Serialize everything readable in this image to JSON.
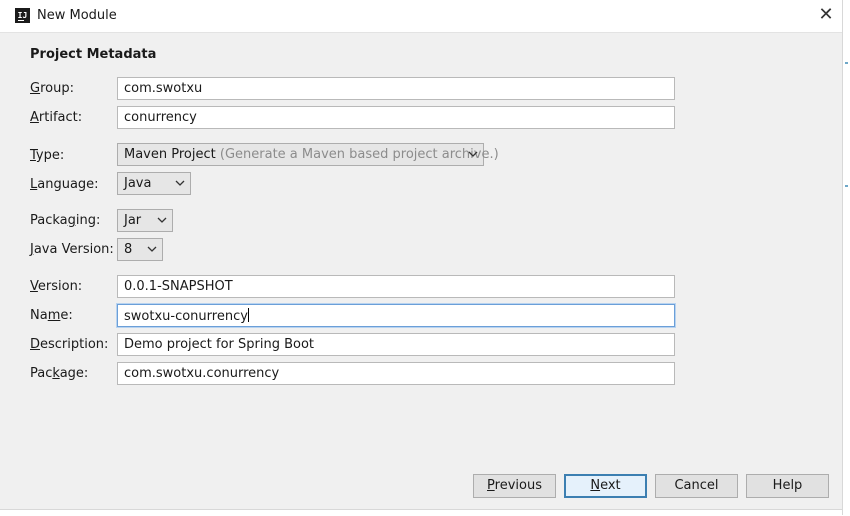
{
  "window": {
    "title": "New Module",
    "close_glyph": "✕"
  },
  "section_title": "Project Metadata",
  "fields": {
    "group": {
      "label_mnemonic": "G",
      "label_rest": "roup:",
      "value": "com.swotxu"
    },
    "artifact": {
      "label_mnemonic": "A",
      "label_rest": "rtifact:",
      "value": "conurrency"
    },
    "type": {
      "label_mnemonic": "T",
      "label_rest": "ype:",
      "value": "Maven Project",
      "hint": "(Generate a Maven based project archive.)"
    },
    "language": {
      "label_mnemonic": "L",
      "label_rest": "anguage:",
      "value": "Java"
    },
    "packaging": {
      "label_pre": "Packa",
      "label_mnemonic": "g",
      "label_rest": "ing:",
      "value": "Jar"
    },
    "java_version": {
      "label_mnemonic": "J",
      "label_rest": "ava Version:",
      "value": "8"
    },
    "version": {
      "label_mnemonic": "V",
      "label_rest": "ersion:",
      "value": "0.0.1-SNAPSHOT"
    },
    "name": {
      "label_pre": "Na",
      "label_mnemonic": "m",
      "label_rest": "e:",
      "value": "swotxu-conurrency"
    },
    "description": {
      "label_mnemonic": "D",
      "label_rest": "escription:",
      "value": "Demo project for Spring Boot"
    },
    "package": {
      "label_pre": "Pac",
      "label_mnemonic": "k",
      "label_rest": "age:",
      "value": "com.swotxu.conurrency"
    }
  },
  "buttons": {
    "previous": {
      "mnemonic": "P",
      "rest": "revious"
    },
    "next": {
      "mnemonic": "N",
      "rest": "ext"
    },
    "cancel": {
      "label": "Cancel"
    },
    "help": {
      "label": "Help"
    }
  },
  "icons": {
    "app": "intellij-icon",
    "close": "close-icon",
    "dropdown": "chevron-down-icon"
  }
}
